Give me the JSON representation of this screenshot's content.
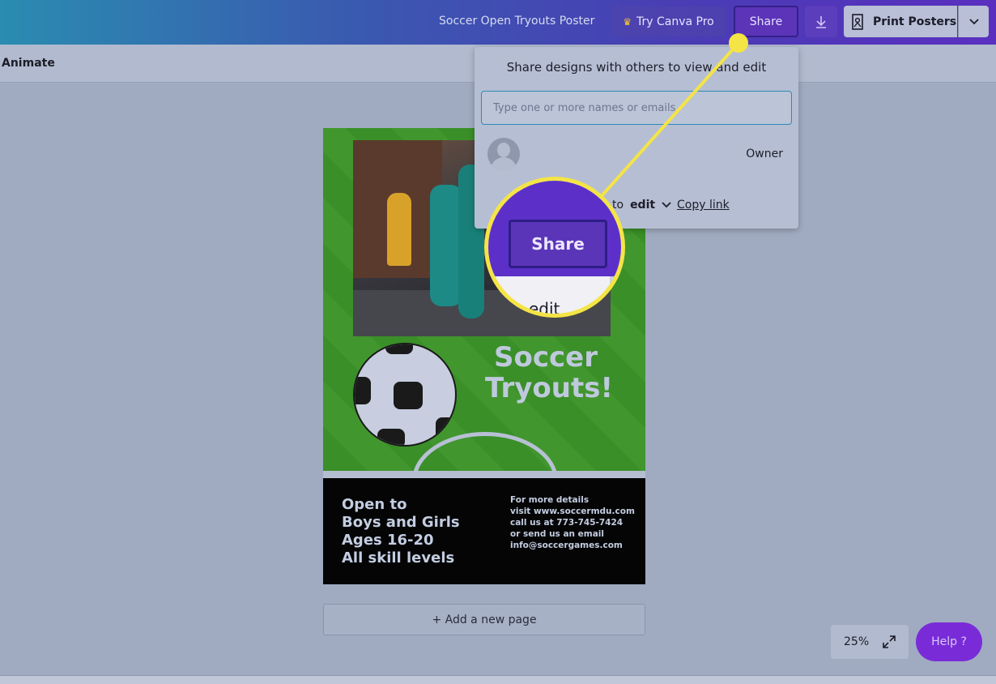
{
  "topbar": {
    "doc_title": "Soccer Open Tryouts Poster",
    "try_pro_label": "Try Canva Pro",
    "share_label": "Share",
    "print_label": "Print Posters"
  },
  "subbar": {
    "animate_label": "Animate"
  },
  "share_panel": {
    "heading": "Share designs with others to view and edit",
    "email_placeholder": "Type one or more names or emails",
    "owner_label": "Owner",
    "permission_prefix": "to",
    "permission_value": "edit",
    "copy_link_label": "Copy link"
  },
  "poster": {
    "title_line1": "Soccer",
    "title_line2": "Tryouts!",
    "open_lines": [
      "Open to",
      "Boys and Girls",
      "Ages 16-20",
      "All skill levels"
    ],
    "details_lines": [
      "For more details",
      "visit www.soccermdu.com",
      "call us at 773-745-7424",
      "or send us an email",
      "info@soccergames.com"
    ]
  },
  "add_page_label": "+ Add a new page",
  "zoom": {
    "level": "25%"
  },
  "help_label": "Help ?",
  "magnifier": {
    "share_label": "Share",
    "edit_label": "edit"
  },
  "colors": {
    "accent_purple": "#5b34b8",
    "callout_yellow": "#f4e446",
    "help_purple": "#7a2bd8"
  },
  "icons": [
    "crown-icon",
    "download-icon",
    "poster-icon",
    "chevron-down-icon",
    "expand-icon",
    "avatar-icon"
  ]
}
